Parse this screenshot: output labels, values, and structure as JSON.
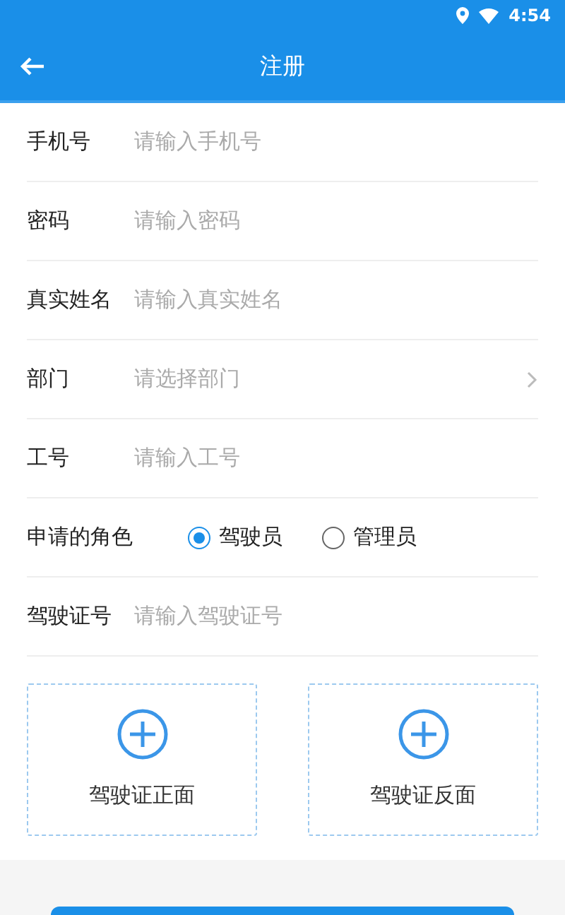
{
  "status_bar": {
    "time": "4:54"
  },
  "app_bar": {
    "title": "注册"
  },
  "fields": [
    {
      "kind": "input",
      "label": "手机号",
      "placeholder": "请输入手机号"
    },
    {
      "kind": "input",
      "label": "密码",
      "placeholder": "请输入密码"
    },
    {
      "kind": "input",
      "label": "真实姓名",
      "placeholder": "请输入真实姓名"
    },
    {
      "kind": "select",
      "label": "部门",
      "placeholder": "请选择部门"
    },
    {
      "kind": "input",
      "label": "工号",
      "placeholder": "请输入工号"
    },
    {
      "kind": "radio",
      "label": "申请的角色",
      "options": [
        {
          "label": "驾驶员",
          "selected": true
        },
        {
          "label": "管理员",
          "selected": false
        }
      ]
    },
    {
      "kind": "input",
      "label": "驾驶证号",
      "placeholder": "请输入驾驶证号"
    }
  ],
  "uploads": [
    {
      "label": "驾驶证正面"
    },
    {
      "label": "驾驶证反面"
    }
  ]
}
